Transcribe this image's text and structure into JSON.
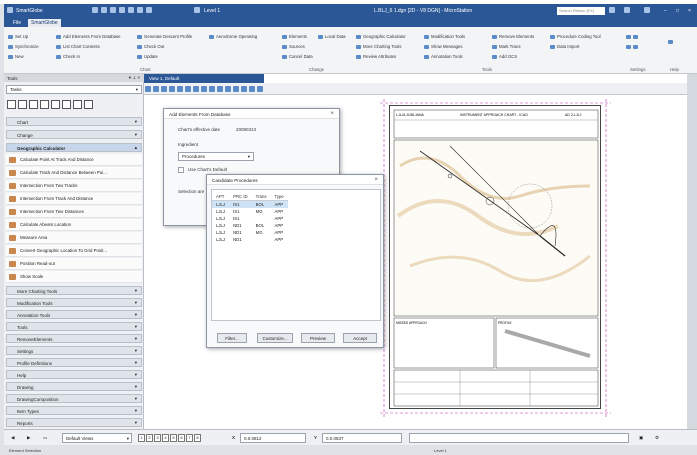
{
  "titlebar": {
    "app_name": "SmartGlobe",
    "level_label": "Level 1",
    "document_title": "L.BLJ_6 1.dgn [2D - V8 DGN] - MicroStation",
    "search_placeholder": "Search Ribbon (F4)"
  },
  "tabs": [
    {
      "label": "File"
    },
    {
      "label": "SmartGlobe"
    }
  ],
  "ribbon": {
    "chart_group": {
      "label": "Chart",
      "items": [
        "Set Up",
        "Synchronize",
        "New",
        "Add Elements From Database",
        "List Chart Contents",
        "Check In",
        "Generate Descent Profile",
        "Check Out",
        "Update",
        "Aerodrome Operating"
      ]
    },
    "change_group": {
      "label": "Change",
      "items": [
        "Elements",
        "Sources",
        "Cancel Data",
        "Local Data"
      ]
    },
    "tools_group": {
      "label": "Tools",
      "items": [
        "Geographic Calculator",
        "More Charting Tools",
        "Review Attributes",
        "Modification Tools",
        "Show Messages",
        "Annotation Tools",
        "Remove Elements",
        "Mark Trans",
        "Add GCS",
        "Procedure Coding Tool",
        "Data Import"
      ]
    },
    "settings_group": {
      "label": "Settings"
    },
    "help_group": {
      "label": "Help"
    }
  },
  "sidebar": {
    "header": "Tools",
    "selector": "Tasks",
    "sections": [
      {
        "label": "Chart"
      },
      {
        "label": "Change"
      },
      {
        "label": "Geographic Calculator",
        "open": true
      }
    ],
    "calculator_items": [
      "Calculate Point At Track And Distance",
      "Calculate Track And Distance Between Poi...",
      "Intersection From Two Tracks",
      "Intersection From Track And Distance",
      "Intersection From Two Distances",
      "Calculate Abeam Location",
      "Measure Area",
      "Convert Geographic Location To Grid Posit...",
      "Position Read-out",
      "Show Scale"
    ],
    "more_sections": [
      "More Charting Tools",
      "Modification Tools",
      "Annotation Tools",
      "Tools",
      "RemoveElements",
      "Settings",
      "Profile Definitions",
      "Help",
      "Drawing",
      "DrawingComposition",
      "Item Types",
      "Reports"
    ]
  },
  "view": {
    "tab_label": "View 1, Default"
  },
  "add_dialog": {
    "title": "Add Elements From Database",
    "effective_date_label": "Chart's effective date",
    "effective_date_value": "20080313",
    "ingredient_label": "Ingredient",
    "ingredient_value": "Procedures",
    "default_checkbox_label": "Use Chart's Default",
    "selection_label": "Selection are"
  },
  "candidate_dialog": {
    "title": "Candidate Procedures",
    "columns": [
      "APT",
      "PRC ID",
      "Trans",
      "Type"
    ],
    "rows": [
      [
        "LJLJ",
        "IS1",
        "BOL",
        "APP"
      ],
      [
        "LJLJ",
        "IS1",
        "MG",
        "APP"
      ],
      [
        "LJLJ",
        "IS1",
        "",
        "APP"
      ],
      [
        "LJLJ",
        "ND1",
        "BOL",
        "APP"
      ],
      [
        "LJLJ",
        "ND1",
        "MG",
        "APP"
      ],
      [
        "LJLJ",
        "ND1",
        "",
        "APP"
      ]
    ],
    "buttons": [
      "Filter...",
      "Customize...",
      "Preview",
      "Accept"
    ]
  },
  "statusbar": {
    "view_label": "Default Views",
    "pages": [
      "1",
      "2",
      "3",
      "4",
      "5",
      "6",
      "7",
      "8"
    ],
    "x_label": "X",
    "x_value": "0.0.0812",
    "y_label": "Y",
    "y_value": "0.0.0837"
  },
  "bottom": {
    "left_text": "Element Selection",
    "right_text": "Level 1"
  },
  "chart_sheet": {
    "header_left": "LJLJ/LJUBLJANA",
    "header_mid": "INSTRUMENT APPROACH CHART - ICAO",
    "header_right": "AD 2-LJLJ",
    "section_missed": "MISSED APPROACH",
    "section_profile": "PROFILE"
  },
  "colors": {
    "brand": "#2b5797",
    "selection": "#cfe3f7"
  }
}
